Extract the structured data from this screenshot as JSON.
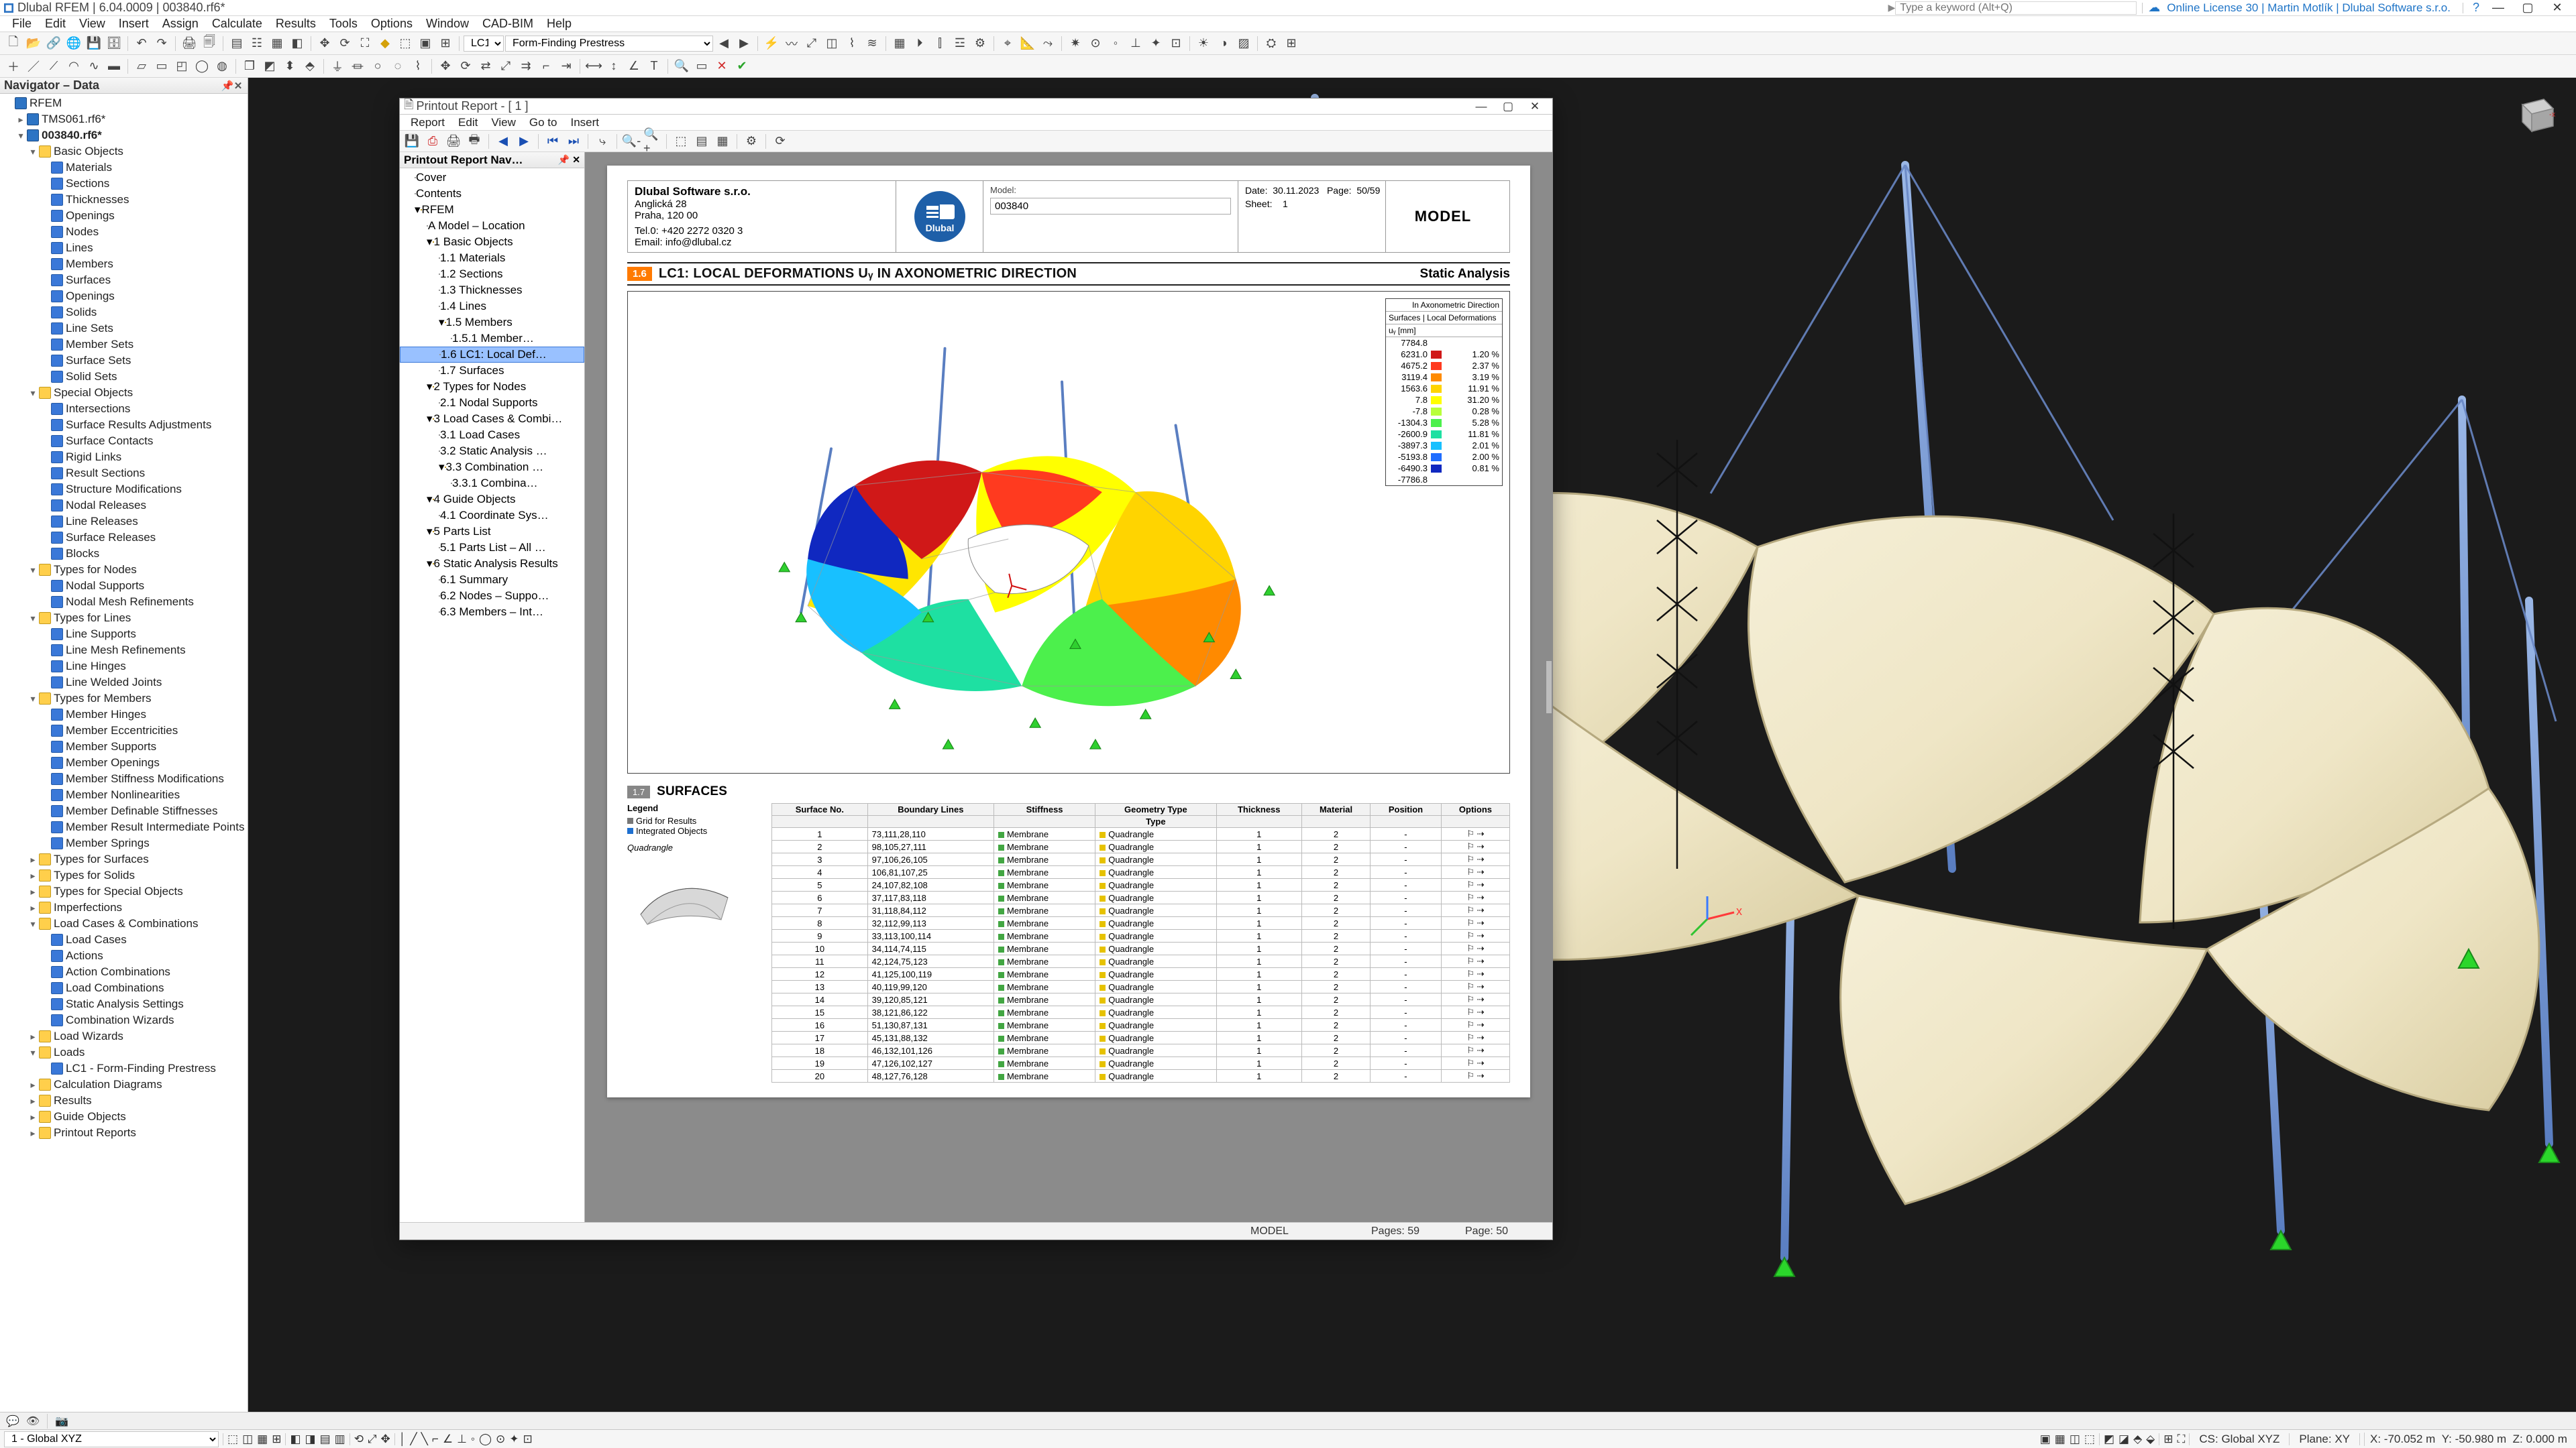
{
  "title_bar": {
    "app": "Dlubal RFEM",
    "ver": "6.04.0009",
    "doc": "003840.rf6*",
    "search_placeholder": "Type a keyword (Alt+Q)",
    "license": "Online License 30 | Martin Motlík | Dlubal Software s.r.o."
  },
  "menu": [
    "File",
    "Edit",
    "View",
    "Insert",
    "Assign",
    "Calculate",
    "Results",
    "Tools",
    "Options",
    "Window",
    "CAD-BIM",
    "Help"
  ],
  "lc_combo_label": "LC1",
  "lc_combo_text": "Form-Finding Prestress",
  "navigator": {
    "title": "Navigator – Data",
    "projects": [
      {
        "name": "RFEM"
      },
      {
        "name": "TMS061.rf6*"
      },
      {
        "name": "003840.rf6*",
        "bold": true
      }
    ],
    "groups": [
      {
        "label": "Basic Objects",
        "children": [
          "Materials",
          "Sections",
          "Thicknesses",
          "Openings",
          "Nodes",
          "Lines",
          "Members",
          "Surfaces",
          "Openings",
          "Solids",
          "Line Sets",
          "Member Sets",
          "Surface Sets",
          "Solid Sets"
        ]
      },
      {
        "label": "Special Objects",
        "children": [
          "Intersections",
          "Surface Results Adjustments",
          "Surface Contacts",
          "Rigid Links",
          "Result Sections",
          "Structure Modifications",
          "Nodal Releases",
          "Line Releases",
          "Surface Releases",
          "Blocks"
        ]
      },
      {
        "label": "Types for Nodes",
        "children": [
          "Nodal Supports",
          "Nodal Mesh Refinements"
        ]
      },
      {
        "label": "Types for Lines",
        "children": [
          "Line Supports",
          "Line Mesh Refinements",
          "Line Hinges",
          "Line Welded Joints"
        ]
      },
      {
        "label": "Types for Members",
        "children": [
          "Member Hinges",
          "Member Eccentricities",
          "Member Supports",
          "Member Openings",
          "Member Stiffness Modifications",
          "Member Nonlinearities",
          "Member Definable Stiffnesses",
          "Member Result Intermediate Points",
          "Member Springs"
        ]
      },
      {
        "label": "Types for Surfaces"
      },
      {
        "label": "Types for Solids"
      },
      {
        "label": "Types for Special Objects"
      },
      {
        "label": "Imperfections"
      },
      {
        "label": "Load Cases & Combinations",
        "children": [
          "Load Cases",
          "Actions",
          "Action Combinations",
          "Load Combinations",
          "Static Analysis Settings",
          "Combination Wizards"
        ]
      },
      {
        "label": "Load Wizards"
      },
      {
        "label": "Loads",
        "children": [
          "LC1 - Form-Finding Prestress"
        ]
      },
      {
        "label": "Calculation Diagrams"
      },
      {
        "label": "Results"
      },
      {
        "label": "Guide Objects"
      },
      {
        "label": "Printout Reports"
      }
    ]
  },
  "status": {
    "left": "1 - Global XYZ",
    "cs": "CS: Global XYZ",
    "plane": "Plane: XY",
    "x": "X: -70.052 m",
    "y": "Y: -50.980 m",
    "z": "Z: 0.000 m"
  },
  "report": {
    "title": "Printout Report - [ 1 ]",
    "menu": [
      "Report",
      "Edit",
      "View",
      "Go to",
      "Insert"
    ],
    "nav_title": "Printout Report Nav…",
    "nav_items": [
      {
        "t": "Cover",
        "l": 1,
        "ic": "doc"
      },
      {
        "t": "Contents",
        "l": 1,
        "ic": "doc"
      },
      {
        "t": "RFEM",
        "l": 1,
        "ic": "fold",
        "exp": true
      },
      {
        "t": "A Model – Location",
        "l": 2,
        "ic": "doc"
      },
      {
        "t": "1 Basic Objects",
        "l": 2,
        "ic": "fold",
        "exp": true
      },
      {
        "t": "1.1 Materials",
        "l": 3,
        "ic": "doc"
      },
      {
        "t": "1.2 Sections",
        "l": 3,
        "ic": "doc"
      },
      {
        "t": "1.3 Thicknesses",
        "l": 3,
        "ic": "doc"
      },
      {
        "t": "1.4 Lines",
        "l": 3,
        "ic": "doc"
      },
      {
        "t": "1.5 Members",
        "l": 3,
        "ic": "fold",
        "exp": true
      },
      {
        "t": "1.5.1 Member…",
        "l": 4,
        "ic": "doc"
      },
      {
        "t": "1.6 LC1: Local Def…",
        "l": 3,
        "ic": "doc",
        "sel": true
      },
      {
        "t": "1.7 Surfaces",
        "l": 3,
        "ic": "doc"
      },
      {
        "t": "2 Types for Nodes",
        "l": 2,
        "ic": "fold",
        "exp": true
      },
      {
        "t": "2.1 Nodal Supports",
        "l": 3,
        "ic": "doc"
      },
      {
        "t": "3 Load Cases & Combi…",
        "l": 2,
        "ic": "fold",
        "exp": true
      },
      {
        "t": "3.1 Load Cases",
        "l": 3,
        "ic": "doc"
      },
      {
        "t": "3.2 Static Analysis …",
        "l": 3,
        "ic": "doc"
      },
      {
        "t": "3.3 Combination …",
        "l": 3,
        "ic": "fold",
        "exp": true
      },
      {
        "t": "3.3.1 Combina…",
        "l": 4,
        "ic": "doc"
      },
      {
        "t": "4 Guide Objects",
        "l": 2,
        "ic": "fold",
        "exp": true
      },
      {
        "t": "4.1 Coordinate Sys…",
        "l": 3,
        "ic": "doc"
      },
      {
        "t": "5 Parts List",
        "l": 2,
        "ic": "fold",
        "exp": true
      },
      {
        "t": "5.1 Parts List – All …",
        "l": 3,
        "ic": "doc"
      },
      {
        "t": "6 Static Analysis Results",
        "l": 2,
        "ic": "fold",
        "exp": true
      },
      {
        "t": "6.1 Summary",
        "l": 3,
        "ic": "doc"
      },
      {
        "t": "6.2 Nodes – Suppo…",
        "l": 3,
        "ic": "doc"
      },
      {
        "t": "6.3 Members – Int…",
        "l": 3,
        "ic": "doc"
      }
    ],
    "page_header": {
      "company": "Dlubal Software s.r.o.",
      "addr1": "Anglická 28",
      "addr2": "Praha, 120 00",
      "tel": "Tel.0: +420 2272 0320 3",
      "email": "Email: info@dlubal.cz",
      "model_label": "Model:",
      "model": "003840",
      "date_label": "Date:",
      "date": "30.11.2023",
      "page_label": "Page:",
      "page": "50/59",
      "sheet_label": "Sheet:",
      "sheet": "1",
      "big": "MODEL"
    },
    "section_title": {
      "badge": "1.6",
      "text": "LC1: LOCAL DEFORMATIONS Uᵧ  IN AXONOMETRIC DIRECTION",
      "right": "Static Analysis"
    },
    "surfaces_title": {
      "badge": "1.7",
      "text": "SURFACES"
    },
    "surf_legend": {
      "title": "Legend",
      "a": "Grid for Results",
      "b": "Integrated Objects",
      "c": "Quadrangle"
    },
    "status_bar": {
      "model": "MODEL",
      "pages": "Pages: 59",
      "page": "Page: 50"
    }
  },
  "chart_data": {
    "type": "heatmap",
    "title": "LC1: Local Deformations Uᵧ (In Axonometric Direction)",
    "subtitle": "Static Analysis",
    "axis_label": "In Axonometric Direction",
    "scale_header": "Surfaces | Local Deformations",
    "unit": "uᵧ [mm]",
    "max_value": 7784.8,
    "bins": [
      {
        "from": 6231.0,
        "color": "#d01818",
        "pct": "1.20 %"
      },
      {
        "from": 4675.2,
        "color": "#ff3a1f",
        "pct": "2.37 %"
      },
      {
        "from": 3119.4,
        "color": "#ff8a00",
        "pct": "3.19 %"
      },
      {
        "from": 1563.6,
        "color": "#ffd400",
        "pct": "11.91 %"
      },
      {
        "from": 7.8,
        "color": "#ffff00",
        "pct": "31.20 %"
      },
      {
        "from": -7.8,
        "color": "#b8ff3a",
        "pct": "0.28 %"
      },
      {
        "from": -1304.3,
        "color": "#4cf04c",
        "pct": "5.28 %"
      },
      {
        "from": -2600.9,
        "color": "#1ee0a2",
        "pct": "11.81 %"
      },
      {
        "from": -3897.3,
        "color": "#18c0ff",
        "pct": "2.01 %"
      },
      {
        "from": -5193.8,
        "color": "#1f6dff",
        "pct": "2.00 %"
      },
      {
        "from": -6490.3,
        "color": "#1028c0",
        "pct": "0.81 %"
      }
    ],
    "min_value": -7786.8
  },
  "surfaces_table": {
    "columns": [
      "Surface No.",
      "Boundary Lines",
      "Stiffness",
      "Geometry Type",
      "Thickness",
      "Material",
      "Position",
      "Options"
    ],
    "rows": [
      {
        "no": 1,
        "bl": "73,111,28,110",
        "st": "Membrane",
        "gt": "Quadrangle",
        "th": 1,
        "ma": 2
      },
      {
        "no": 2,
        "bl": "98,105,27,111",
        "st": "Membrane",
        "gt": "Quadrangle",
        "th": 1,
        "ma": 2
      },
      {
        "no": 3,
        "bl": "97,106,26,105",
        "st": "Membrane",
        "gt": "Quadrangle",
        "th": 1,
        "ma": 2
      },
      {
        "no": 4,
        "bl": "106,81,107,25",
        "st": "Membrane",
        "gt": "Quadrangle",
        "th": 1,
        "ma": 2
      },
      {
        "no": 5,
        "bl": "24,107,82,108",
        "st": "Membrane",
        "gt": "Quadrangle",
        "th": 1,
        "ma": 2
      },
      {
        "no": 6,
        "bl": "37,117,83,118",
        "st": "Membrane",
        "gt": "Quadrangle",
        "th": 1,
        "ma": 2
      },
      {
        "no": 7,
        "bl": "31,118,84,112",
        "st": "Membrane",
        "gt": "Quadrangle",
        "th": 1,
        "ma": 2
      },
      {
        "no": 8,
        "bl": "32,112,99,113",
        "st": "Membrane",
        "gt": "Quadrangle",
        "th": 1,
        "ma": 2
      },
      {
        "no": 9,
        "bl": "33,113,100,114",
        "st": "Membrane",
        "gt": "Quadrangle",
        "th": 1,
        "ma": 2
      },
      {
        "no": 10,
        "bl": "34,114,74,115",
        "st": "Membrane",
        "gt": "Quadrangle",
        "th": 1,
        "ma": 2
      },
      {
        "no": 11,
        "bl": "42,124,75,123",
        "st": "Membrane",
        "gt": "Quadrangle",
        "th": 1,
        "ma": 2
      },
      {
        "no": 12,
        "bl": "41,125,100,119",
        "st": "Membrane",
        "gt": "Quadrangle",
        "th": 1,
        "ma": 2
      },
      {
        "no": 13,
        "bl": "40,119,99,120",
        "st": "Membrane",
        "gt": "Quadrangle",
        "th": 1,
        "ma": 2
      },
      {
        "no": 14,
        "bl": "39,120,85,121",
        "st": "Membrane",
        "gt": "Quadrangle",
        "th": 1,
        "ma": 2
      },
      {
        "no": 15,
        "bl": "38,121,86,122",
        "st": "Membrane",
        "gt": "Quadrangle",
        "th": 1,
        "ma": 2
      },
      {
        "no": 16,
        "bl": "51,130,87,131",
        "st": "Membrane",
        "gt": "Quadrangle",
        "th": 1,
        "ma": 2
      },
      {
        "no": 17,
        "bl": "45,131,88,132",
        "st": "Membrane",
        "gt": "Quadrangle",
        "th": 1,
        "ma": 2
      },
      {
        "no": 18,
        "bl": "46,132,101,126",
        "st": "Membrane",
        "gt": "Quadrangle",
        "th": 1,
        "ma": 2
      },
      {
        "no": 19,
        "bl": "47,126,102,127",
        "st": "Membrane",
        "gt": "Quadrangle",
        "th": 1,
        "ma": 2
      },
      {
        "no": 20,
        "bl": "48,127,76,128",
        "st": "Membrane",
        "gt": "Quadrangle",
        "th": 1,
        "ma": 2
      }
    ]
  }
}
